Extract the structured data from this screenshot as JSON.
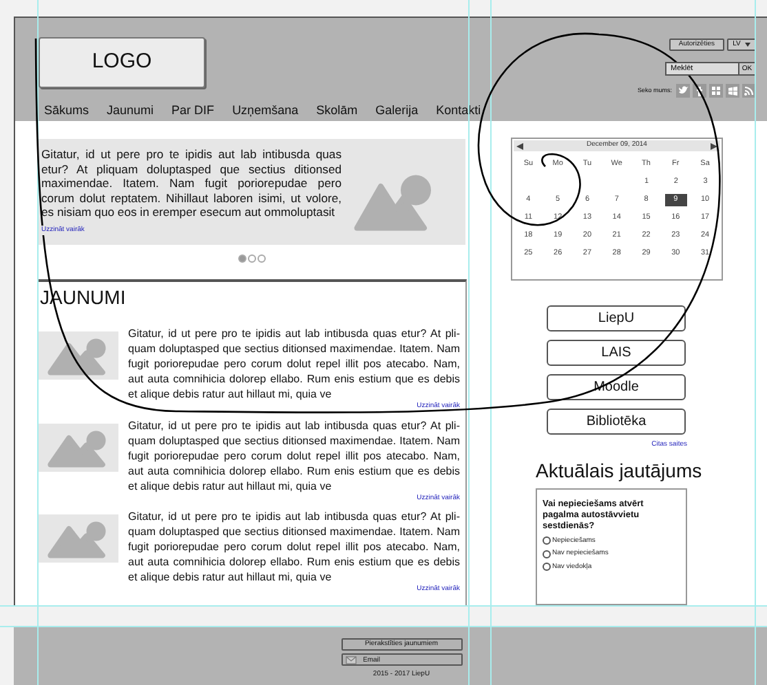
{
  "header": {
    "logo": "LOGO",
    "nav": [
      {
        "label": "Sākums"
      },
      {
        "label": "Jaunumi"
      },
      {
        "label": "Par DIF"
      },
      {
        "label": "Uzņemšana"
      },
      {
        "label": "Skolām"
      },
      {
        "label": "Galerija"
      },
      {
        "label": "Kontakti"
      }
    ],
    "login_button": "Autorizēties",
    "language": "LV",
    "search": {
      "value": "Meklēt"
    },
    "search_button": "OK",
    "follow_label": "Seko mums:",
    "social": [
      {
        "kind": "bird"
      },
      {
        "kind": "f"
      },
      {
        "kind": "grid"
      },
      {
        "kind": "window"
      },
      {
        "kind": "rss"
      }
    ]
  },
  "slider": {
    "text": "Gitatur, id ut pere pro te ipidis aut lab intibusda quas etur? At pliquam doluptasped que sectius ditionsed maximendae. Itatem. Nam fugit poriorepudae pero corum dolut reptatem. Nihillaut laboren isimi, ut volore, es nisiam quo eos in eremper esecum aut ommoluptasit",
    "link": "Uzzināt vairāk",
    "slides": [
      {
        "selected": true
      },
      {
        "selected": false
      },
      {
        "selected": false
      }
    ]
  },
  "news": {
    "title": "JAUNUMI",
    "items": [
      {
        "text": "Gitatur, id ut pere pro te ipidis aut lab intibusda quas etur? At pli-quam doluptasped que sectius ditionsed maximendae. Itatem. Nam fugit poriorepudae pero corum dolut repel illit pos atecabo. Nam, aut auta comnihicia dolorep ellabo. Rum enis estium que es debis et alique debis ratur aut hillaut mi, quia ve",
        "link": "Uzzināt vairāk"
      },
      {
        "text": "Gitatur, id ut pere pro te ipidis aut lab intibusda quas etur? At pli-quam doluptasped que sectius ditionsed maximendae. Itatem. Nam fugit poriorepudae pero corum dolut repel illit pos atecabo. Nam, aut auta comnihicia dolorep ellabo. Rum enis estium que es debis et alique debis ratur aut hillaut mi, quia ve",
        "link": "Uzzināt vairāk"
      },
      {
        "text": "Gitatur, id ut pere pro te ipidis aut lab intibusda quas etur? At pli-quam doluptasped que sectius ditionsed maximendae. Itatem. Nam fugit poriorepudae pero corum dolut repel illit pos atecabo. Nam, aut auta comnihicia dolorep ellabo. Rum enis estium que es debis et alique debis ratur aut hillaut mi, quia ve",
        "link": "Uzzināt vairāk"
      }
    ]
  },
  "calendar": {
    "title": "December 09, 2014",
    "weekdays": [
      "Su",
      "Mo",
      "Tu",
      "We",
      "Th",
      "Fr",
      "Sa"
    ],
    "weeks": [
      [
        {
          "label": "1",
          "selected": false
        },
        {
          "label": "2",
          "selected": false
        },
        {
          "label": "3",
          "selected": false
        }
      ],
      [
        {
          "label": "4",
          "selected": false
        },
        {
          "label": "5",
          "selected": false
        },
        {
          "label": "6",
          "selected": false
        },
        {
          "label": "7",
          "selected": false
        },
        {
          "label": "8",
          "selected": false
        },
        {
          "label": "9",
          "selected": true
        },
        {
          "label": "10",
          "selected": false
        }
      ],
      [
        {
          "label": "11",
          "selected": false
        },
        {
          "label": "12",
          "selected": false
        },
        {
          "label": "13",
          "selected": false
        },
        {
          "label": "14",
          "selected": false
        },
        {
          "label": "15",
          "selected": false
        },
        {
          "label": "16",
          "selected": false
        },
        {
          "label": "17",
          "selected": false
        }
      ],
      [
        {
          "label": "18",
          "selected": false
        },
        {
          "label": "19",
          "selected": false
        },
        {
          "label": "20",
          "selected": false
        },
        {
          "label": "21",
          "selected": false
        },
        {
          "label": "22",
          "selected": false
        },
        {
          "label": "23",
          "selected": false
        },
        {
          "label": "24",
          "selected": false
        }
      ],
      [
        {
          "label": "25",
          "selected": false
        },
        {
          "label": "26",
          "selected": false
        },
        {
          "label": "27",
          "selected": false
        },
        {
          "label": "28",
          "selected": false
        },
        {
          "label": "29",
          "selected": false
        },
        {
          "label": "30",
          "selected": false
        },
        {
          "label": "31",
          "selected": false
        }
      ]
    ]
  },
  "links": [
    "LiepU",
    "LAIS",
    "Moodle",
    "Bibliotēka"
  ],
  "other_links": "Citas saites",
  "poll": {
    "title": "Aktuālais jautājums",
    "question": "Vai nepieciešams atvērt pagalma autostāvvietu sestdienās?",
    "options": [
      {
        "label": "Nepieciešams",
        "selected": false
      },
      {
        "label": "Nav nepieciešams",
        "selected": false
      },
      {
        "label": "Nav viedokļa",
        "selected": false
      }
    ]
  },
  "footer": {
    "subscribe_button": "Pierakstīties jaunumiem",
    "email": {
      "placeholder": "Email"
    },
    "copyright": "2015 - 2017 LiepU"
  }
}
